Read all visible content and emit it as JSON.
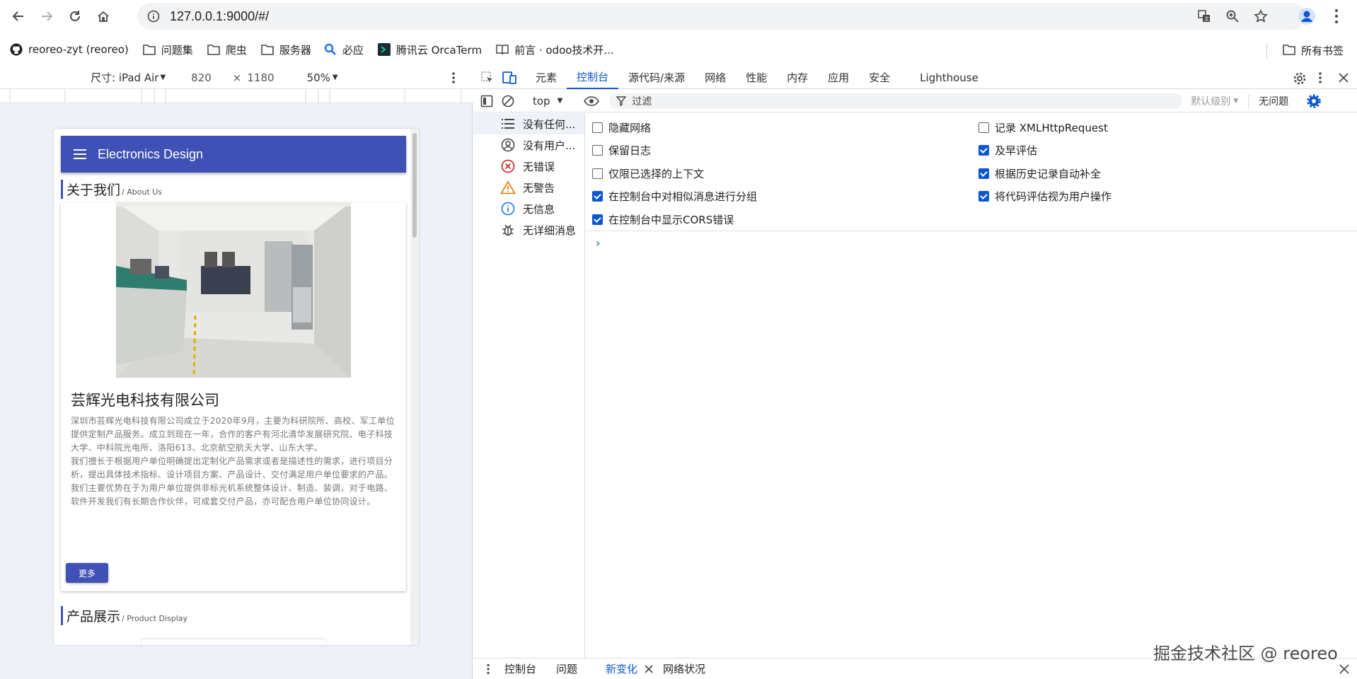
{
  "browser": {
    "url": "127.0.0.1:9000/#/"
  },
  "bookmarks": [
    {
      "label": "reoreo-zyt (reoreo)",
      "icon": "github-icon"
    },
    {
      "label": "问题集",
      "icon": "folder-icon"
    },
    {
      "label": "爬虫",
      "icon": "folder-icon"
    },
    {
      "label": "服务器",
      "icon": "folder-icon"
    },
    {
      "label": "必应",
      "icon": "search-icon"
    },
    {
      "label": "腾讯云 OrcaTerm",
      "icon": "terminal-icon"
    },
    {
      "label": "前言 · odoo技术开...",
      "icon": "book-icon"
    }
  ],
  "bookmarks_all": "所有书签",
  "device_toolbar": {
    "device": "尺寸: iPad Air",
    "width": "820",
    "times": "×",
    "height": "1180",
    "zoom": "50%"
  },
  "page": {
    "app_title": "Electronics Design",
    "about_zh": "关于我们",
    "about_en": "/ About Us",
    "company": "芸辉光电科技有限公司",
    "paragraphs": [
      "深圳市芸辉光电科技有限公司成立于2020年9月，主要为科研院所、高校、军工单位提供定制产品服务。成立到现在一年，合作的客户有河北清华发展研究院、电子科技大学、中科院光电所、洛阳613、北京航空航天大学、山东大学。",
      "我们擅长于根据用户单位明确提出定制化产品需求或者是描述性的需求，进行项目分析，提出具体技术指标、设计项目方案、产品设计、交付满足用户单位要求的产品。",
      "我们主要优势在于为用户单位提供非标光机系统整体设计、制造、装调，对于电路、软件开发我们有长期合作伙伴，可成套交付产品，亦可配合用户单位协同设计。"
    ],
    "more_button": "更多",
    "product_zh": "产品展示",
    "product_en": "/ Product Display"
  },
  "devtools": {
    "tabs": [
      "元素",
      "控制台",
      "源代码/来源",
      "网络",
      "性能",
      "内存",
      "应用",
      "安全",
      "Lighthouse"
    ],
    "active_tab": "控制台",
    "context": "top",
    "filter_placeholder": "过滤",
    "level": "默认级别",
    "issues": "无问题",
    "sidebar": [
      {
        "label": "没有任何...",
        "icon": "list-icon"
      },
      {
        "label": "没有用户...",
        "icon": "user-circle-icon"
      },
      {
        "label": "无错误",
        "icon": "error-icon"
      },
      {
        "label": "无警告",
        "icon": "warning-icon"
      },
      {
        "label": "无信息",
        "icon": "info-icon"
      },
      {
        "label": "无详细消息",
        "icon": "bug-icon"
      }
    ],
    "settings_left": [
      {
        "label": "隐藏网络",
        "checked": false
      },
      {
        "label": "保留日志",
        "checked": false
      },
      {
        "label": "仅限已选择的上下文",
        "checked": false
      },
      {
        "label": "在控制台中对相似消息进行分组",
        "checked": true
      },
      {
        "label": "在控制台中显示CORS错误",
        "checked": true
      }
    ],
    "settings_right": [
      {
        "label": "记录 XMLHttpRequest",
        "checked": false
      },
      {
        "label": "及早评估",
        "checked": true
      },
      {
        "label": "根据历史记录自动补全",
        "checked": true
      },
      {
        "label": "将代码评估视为用户操作",
        "checked": true
      }
    ],
    "drawer_tabs": [
      "控制台",
      "问题",
      "新变化",
      "网络状况"
    ],
    "drawer_active": "新变化"
  },
  "watermark": "掘金技术社区 @ reoreo",
  "colors": {
    "brand": "#3f51b5",
    "devtools_accent": "#0b57d0"
  }
}
